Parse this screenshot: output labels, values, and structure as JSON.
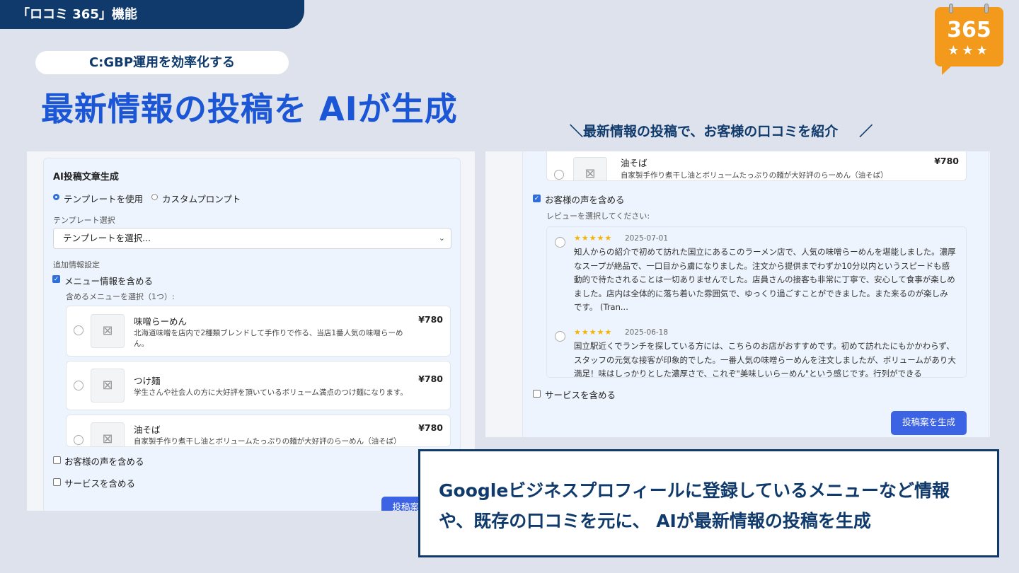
{
  "banner": {
    "label": "「ロコミ 365」機能"
  },
  "logo": {
    "number": "365",
    "stars": "★★★",
    "brand_color": "#f39a1c"
  },
  "subtitle": "C:GBP運用を効率化する",
  "title": "最新情報の投稿を AIが生成",
  "caption": {
    "left_mark": "＼",
    "text": "最新情報の投稿で、お客様の口コミを紹介",
    "right_mark": "／"
  },
  "left_panel": {
    "heading": "AI投稿文章生成",
    "mode_options": [
      "テンプレートを使用",
      "カスタムプロンプト"
    ],
    "mode_selected": "テンプレートを使用",
    "template_label": "テンプレート選択",
    "template_select_value": "テンプレートを選択...",
    "extra_label": "追加情報設定",
    "include_menu_label": "メニュー情報を含める",
    "include_menu_checked": true,
    "menu_select_label": "含めるメニューを選択（1つ）:",
    "menu_items": [
      {
        "name": "味噌らーめん",
        "desc": "北海道味噌を店内で2種類ブレンドして手作りで作る、当店1番人気の味噌らーめん。",
        "price": "¥780"
      },
      {
        "name": "つけ麺",
        "desc": "学生さんや社会人の方に大好評を頂いているボリューム満点のつけ麺になります。",
        "price": "¥780"
      },
      {
        "name": "油そば",
        "desc": "自家製手作り煮干し油とボリュームたっぷりの麺が大好評のらーめん（油そば）",
        "price": "¥780"
      }
    ],
    "include_voice_label": "お客様の声を含める",
    "include_service_label": "サービスを含める",
    "generate_button": "投稿案を生成"
  },
  "right_panel": {
    "menu_item": {
      "name": "油そば",
      "desc": "自家製手作り煮干し油とボリュームたっぷりの麺が大好評のらーめん（油そば）",
      "price": "¥780"
    },
    "include_voice_label": "お客様の声を含める",
    "include_voice_checked": true,
    "review_select_label": "レビューを選択してください:",
    "reviews": [
      {
        "rating": 5,
        "stars": "★★★★★",
        "date": "2025-07-01",
        "text": "知人からの紹介で初めて訪れた国立にあるこのラーメン店で、人気の味噌らーめんを堪能しました。濃厚なスープが絶品で、一口目から虜になりました。注文から提供までわずか10分以内というスピードも感動的で待たされることは一切ありませんでした。店員さんの接客も非常に丁寧で、安心して食事が楽しめました。店内は全体的に落ち着いた雰囲気で、ゆっくり過ごすことができました。また来るのが楽しみです。 (Tran..."
      },
      {
        "rating": 5,
        "stars": "★★★★★",
        "date": "2025-06-18",
        "text": "国立駅近くでランチを探している方には、こちらのお店がおすすめです。初めて訪れたにもかかわらず、スタッフの元気な接客が印象的でした。一番人気の味噌らーめんを注文しましたが、ボリュームがあり大満足！味はしっかりとした濃厚さで、これぞ\"美味しいらーめん\"という感じです。行列ができる"
      }
    ],
    "include_service_label": "サービスを含める",
    "generate_button": "投稿案を生成"
  },
  "description": "Googleビジネスプロフィールに登録しているメニューなど情報や、既存の口コミを元に、 AIが最新情報の投稿を生成"
}
